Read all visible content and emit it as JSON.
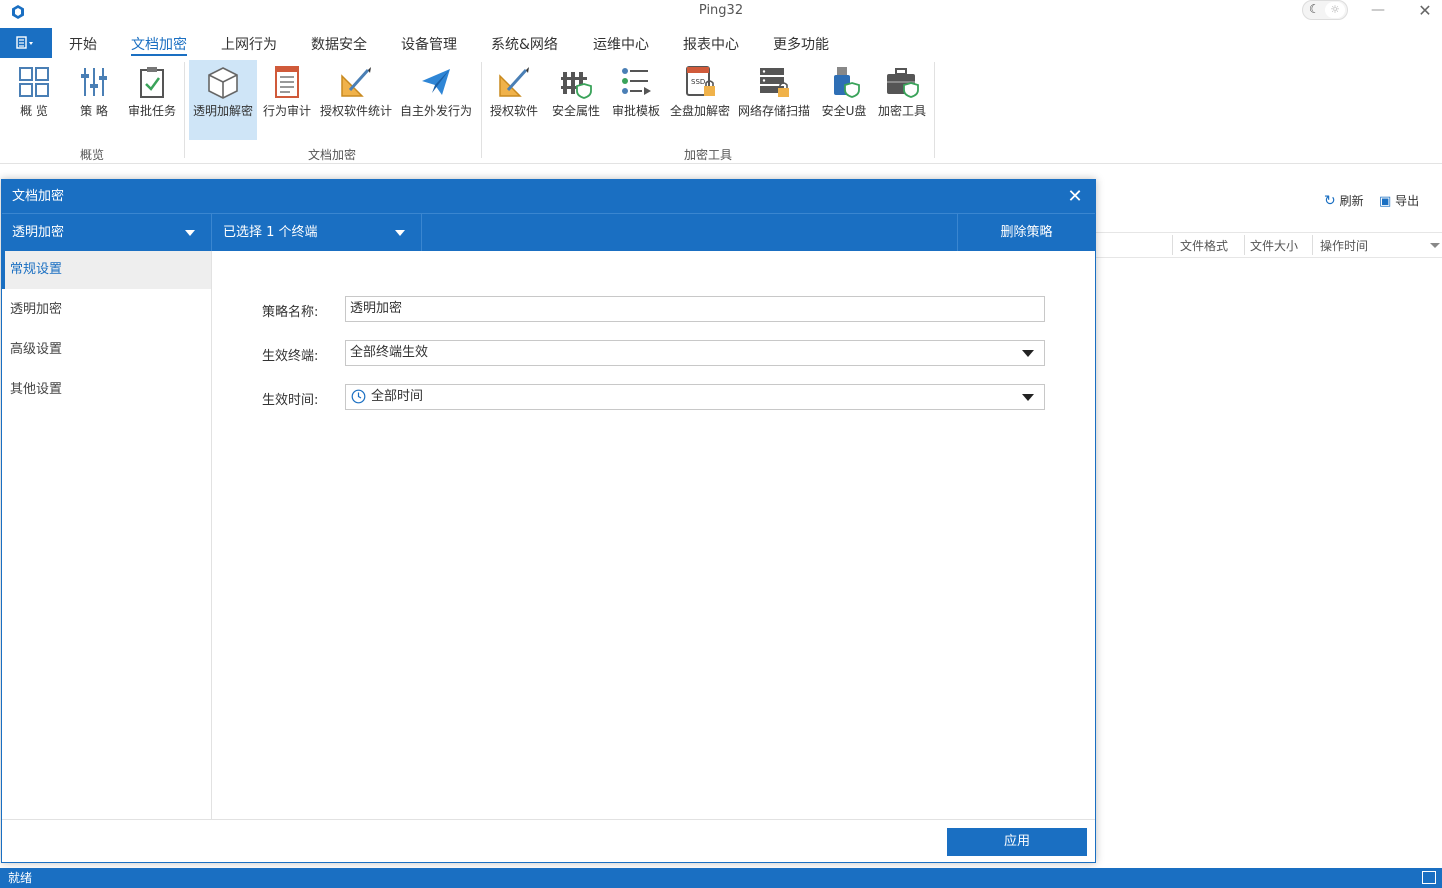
{
  "app": {
    "title": "Ping32"
  },
  "menu": {
    "tabs": [
      "开始",
      "文档加密",
      "上网行为",
      "数据安全",
      "设备管理",
      "系统&网络",
      "运维中心",
      "报表中心",
      "更多功能"
    ],
    "active_tab": "文档加密"
  },
  "ribbon": {
    "items": [
      {
        "label": "概 览",
        "icon": "overview-grid-icon"
      },
      {
        "label": "策 略",
        "icon": "policy-sliders-icon"
      },
      {
        "label": "审批任务",
        "icon": "approval-clipboard-icon"
      },
      {
        "label": "透明加解密",
        "icon": "transparent-encryption-cube-icon"
      },
      {
        "label": "行为审计",
        "icon": "behavior-audit-doc-icon"
      },
      {
        "label": "授权软件统计",
        "icon": "authorized-software-stats-icon"
      },
      {
        "label": "自主外发行为",
        "icon": "send-paper-plane-icon"
      },
      {
        "label": "授权软件",
        "icon": "authorized-software-icon"
      },
      {
        "label": "安全属性",
        "icon": "security-attribute-icon"
      },
      {
        "label": "审批模板",
        "icon": "approval-template-icon"
      },
      {
        "label": "全盘加解密",
        "icon": "ssd-full-disk-encryption-icon"
      },
      {
        "label": "网络存储扫描",
        "icon": "network-storage-scan-icon"
      },
      {
        "label": "安全U盘",
        "icon": "secure-usb-icon"
      },
      {
        "label": "加密工具",
        "icon": "encryption-toolbox-icon"
      }
    ],
    "groups": [
      "概览",
      "文档加密",
      "加密工具"
    ]
  },
  "background": {
    "refresh_label": "刷新",
    "export_label": "导出",
    "columns": [
      "文件格式",
      "文件大小",
      "操作时间"
    ]
  },
  "dialog": {
    "title": "文档加密",
    "policy_select": "透明加密",
    "terminal_select": "已选择 1 个终端",
    "delete_label": "删除策略",
    "sidebar": [
      "常规设置",
      "透明加密",
      "高级设置",
      "其他设置"
    ],
    "active_side": "常规设置",
    "form": {
      "name_label": "策略名称:",
      "name_value": "透明加密",
      "terminal_label": "生效终端:",
      "terminal_value": "全部终端生效",
      "time_label": "生效时间:",
      "time_value": "全部时间"
    },
    "apply_label": "应用"
  },
  "status": {
    "text": "就绪"
  },
  "colors": {
    "accent": "#1a6fc2",
    "ribbon_active": "#cfe5f7"
  }
}
